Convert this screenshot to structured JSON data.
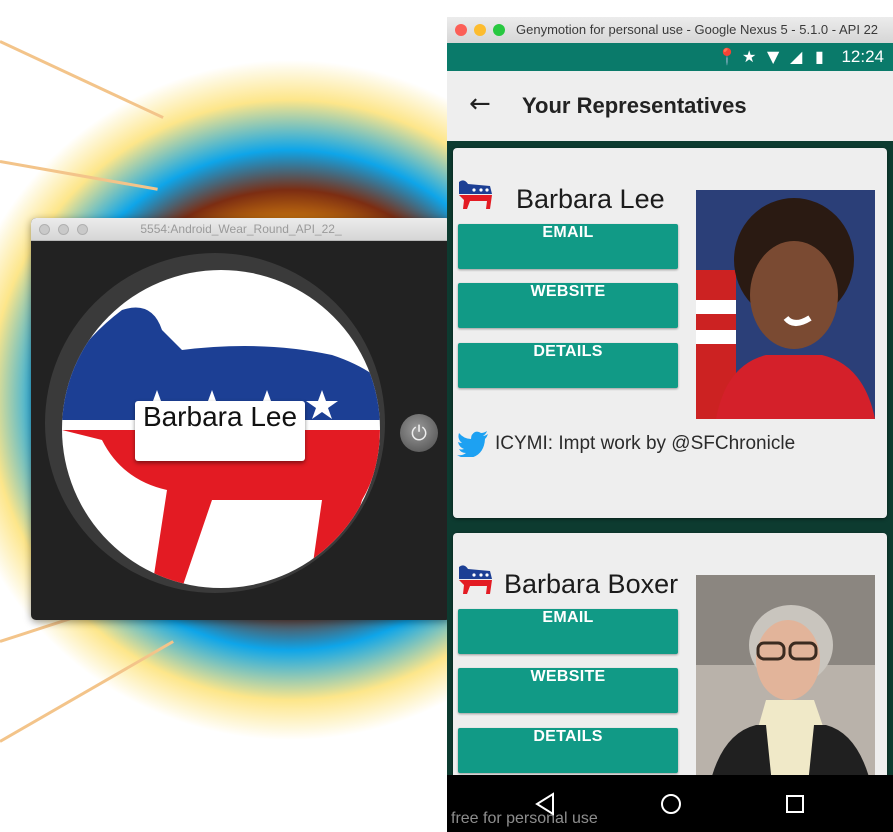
{
  "wear_window": {
    "title": "5554:Android_Wear_Round_API_22_",
    "card_name": "Barbara Lee",
    "icons": [
      "democrat-donkey-icon",
      "power-icon"
    ]
  },
  "phone_window": {
    "title": "Genymotion for personal use - Google Nexus 5 - 5.1.0 - API 22",
    "status_time": "12:24",
    "status_icons": [
      "location-icon",
      "star-icon",
      "wifi-icon",
      "signal-icon",
      "battery-icon"
    ],
    "app_title": "Your Representatives",
    "representatives": [
      {
        "name": "Barbara Lee",
        "buttons": [
          "EMAIL",
          "WEBSITE",
          "DETAILS"
        ],
        "tweet": "ICYMI: Impt work by @SFChronicle"
      },
      {
        "name": "Barbara Boxer",
        "buttons": [
          "EMAIL",
          "WEBSITE",
          "DETAILS"
        ]
      }
    ],
    "watermark": "free for personal use"
  },
  "colors": {
    "accent": "#119a86",
    "status_bar": "#0a7a6a",
    "democrat_blue": "#1c3f94",
    "democrat_red": "#e31b23"
  }
}
